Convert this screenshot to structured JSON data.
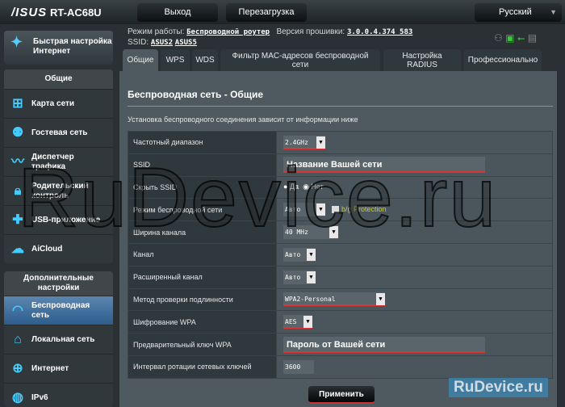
{
  "header": {
    "logo": "/ISUS",
    "model": "RT-AC68U",
    "logout": "Выход",
    "reboot": "Перезагрузка",
    "language": "Русский"
  },
  "info": {
    "mode_label": "Режим работы:",
    "mode": "Беспроводной роутер",
    "fw_label": "Версия прошивки:",
    "fw": "3.0.0.4.374_583",
    "ssid_label": "SSID:",
    "ssid1": "ASUS2",
    "ssid2": "ASUS5"
  },
  "sidebar": {
    "quick_setup": "Быстрая настройка Интернет",
    "general_title": "Общие",
    "general": [
      {
        "label": "Карта сети",
        "icon": "network-map-icon"
      },
      {
        "label": "Гостевая сеть",
        "icon": "guest-icon"
      },
      {
        "label": "Диспетчер трафика",
        "icon": "traffic-icon"
      },
      {
        "label": "Родительский контроль",
        "icon": "lock-icon"
      },
      {
        "label": "USB-приложение",
        "icon": "puzzle-icon"
      },
      {
        "label": "AiCloud",
        "icon": "cloud-icon"
      }
    ],
    "advanced_title": "Дополнительные настройки",
    "advanced": [
      {
        "label": "Беспроводная сеть",
        "icon": "wifi-icon"
      },
      {
        "label": "Локальная сеть",
        "icon": "home-icon"
      },
      {
        "label": "Интернет",
        "icon": "globe-icon"
      },
      {
        "label": "IPv6",
        "icon": "ipv6-icon"
      }
    ]
  },
  "tabs": [
    "Общие",
    "WPS",
    "WDS",
    "Фильтр MAC-адресов беспроводной сети",
    "Настройка RADIUS",
    "Профессионально"
  ],
  "section": {
    "title": "Беспроводная сеть - Общие",
    "subtitle": "Установка беспроводного соединения зависит от информации ниже"
  },
  "form": {
    "band": {
      "label": "Частотный диапазон",
      "value": "2.4GHz"
    },
    "ssid": {
      "label": "SSID",
      "value": "Название Вашей сети"
    },
    "hide": {
      "label": "Скрыть SSID",
      "yes": "Да",
      "no": "Нет"
    },
    "mode": {
      "label": "Режим беспроводной сети",
      "value": "Авто",
      "protection": "b/g Protection"
    },
    "width": {
      "label": "Ширина канала",
      "value": "40 MHz"
    },
    "channel": {
      "label": "Канал",
      "value": "Авто"
    },
    "ext": {
      "label": "Расширенный канал",
      "value": "Авто"
    },
    "auth": {
      "label": "Метод проверки подлинности",
      "value": "WPA2-Personal"
    },
    "enc": {
      "label": "Шифрование WPA",
      "value": "AES"
    },
    "key": {
      "label": "Предварительный ключ WPA",
      "value": "Пароль от Вашей сети"
    },
    "interval": {
      "label": "Интервал ротации сетевых ключей",
      "value": "3600"
    }
  },
  "apply": "Применить",
  "watermark": "RuDevice.ru",
  "watermark_logo": "RuDevice.ru"
}
